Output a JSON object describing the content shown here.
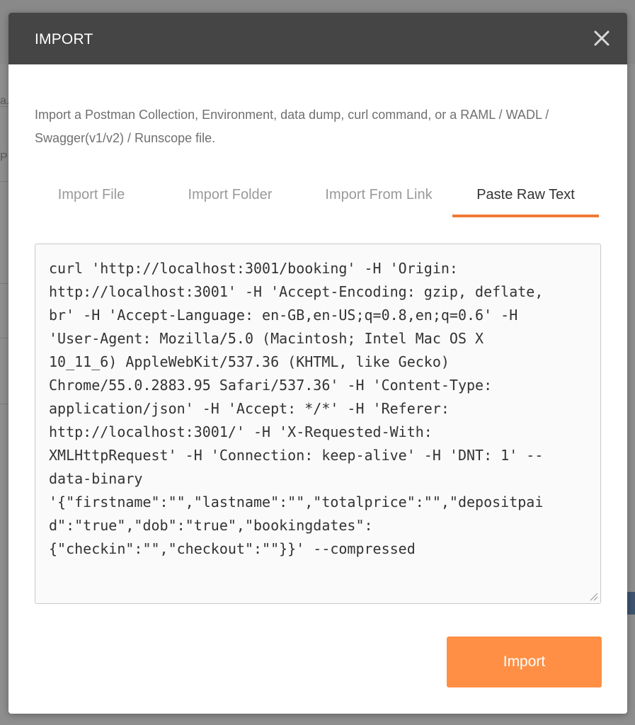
{
  "background": {
    "fragment_a": "a.",
    "fragment_p": "P"
  },
  "modal": {
    "title": "IMPORT",
    "close_symbol": "×",
    "description": "Import a Postman Collection, Environment, data dump, curl command, or a RAML / WADL / Swagger(v1/v2) / Runscope file.",
    "tabs": [
      {
        "label": "Import File",
        "active": false
      },
      {
        "label": "Import Folder",
        "active": false
      },
      {
        "label": "Import From Link",
        "active": false
      },
      {
        "label": "Paste Raw Text",
        "active": true
      }
    ],
    "raw_text": "curl 'http://localhost:3001/booking' -H 'Origin:\nhttp://localhost:3001' -H 'Accept-Encoding: gzip, deflate,\nbr' -H 'Accept-Language: en-GB,en-US;q=0.8,en;q=0.6' -H\n'User-Agent: Mozilla/5.0 (Macintosh; Intel Mac OS X\n10_11_6) AppleWebKit/537.36 (KHTML, like Gecko)\nChrome/55.0.2883.95 Safari/537.36' -H 'Content-Type:\napplication/json' -H 'Accept: */*' -H 'Referer:\nhttp://localhost:3001/' -H 'X-Requested-With:\nXMLHttpRequest' -H 'Connection: keep-alive' -H 'DNT: 1' --\ndata-binary\n'{\"firstname\":\"\",\"lastname\":\"\",\"totalprice\":\"\",\"depositpai\nd\":\"true\",\"dob\":\"true\",\"bookingdates\":\n{\"checkin\":\"\",\"checkout\":\"\"}}' --compressed",
    "import_button_label": "Import"
  },
  "colors": {
    "header_bg": "#454545",
    "accent": "#f07a36",
    "button_bg": "#ff8f45"
  },
  "icons": {
    "close": "close-icon",
    "resize": "resize-grip-icon"
  }
}
